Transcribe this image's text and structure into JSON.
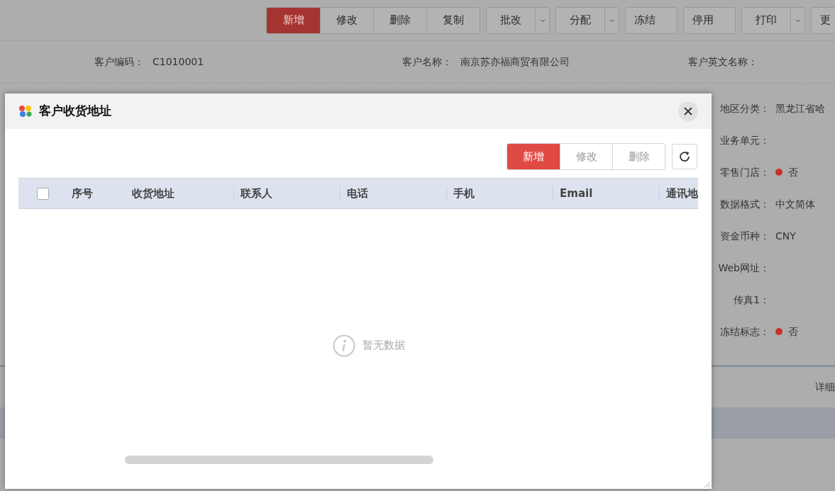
{
  "toolbar": {
    "groups": [
      {
        "kind": "joined",
        "buttons": [
          {
            "label": "新增",
            "primary": true
          },
          {
            "label": "修改",
            "primary": false
          },
          {
            "label": "删除",
            "primary": false
          },
          {
            "label": "复制",
            "primary": false
          }
        ]
      },
      {
        "kind": "split",
        "buttons": [
          {
            "label": "批改",
            "primary": false
          }
        ]
      },
      {
        "kind": "split",
        "buttons": [
          {
            "label": "分配",
            "primary": false
          }
        ]
      },
      {
        "kind": "plain",
        "buttons": [
          {
            "label": "冻结",
            "primary": false
          }
        ]
      },
      {
        "kind": "plain",
        "buttons": [
          {
            "label": "停用",
            "primary": false
          }
        ]
      },
      {
        "kind": "split",
        "buttons": [
          {
            "label": "打印",
            "primary": false
          }
        ]
      },
      {
        "kind": "plain",
        "buttons": [
          {
            "label": "更",
            "primary": false
          }
        ]
      }
    ]
  },
  "header_fields": [
    {
      "label": "客户编码：",
      "value": "C1010001"
    },
    {
      "label": "客户名称：",
      "value": "南京苏亦福商贸有限公司"
    },
    {
      "label": "客户英文名称："
    }
  ],
  "side_fields": [
    {
      "label": "地区分类：",
      "value": "黑龙江省哈",
      "kind": "text"
    },
    {
      "label": "业务单元：",
      "kind": "text"
    },
    {
      "label": "零售门店：",
      "value": "否",
      "kind": "flag",
      "color": "#c9302c"
    },
    {
      "label": "数据格式：",
      "value": "中文简体",
      "kind": "text"
    },
    {
      "label": "资金币种：",
      "value": "CNY",
      "kind": "text"
    },
    {
      "label": "Web网址：",
      "kind": "text"
    },
    {
      "label": "传真1：",
      "kind": "text"
    },
    {
      "label": "冻结标志：",
      "value": "否",
      "kind": "flag",
      "color": "#c9302c"
    }
  ],
  "detail_tab": "详细",
  "dialog": {
    "title": "客户收货地址",
    "buttons": [
      {
        "label": "新增",
        "primary": true
      },
      {
        "label": "修改",
        "primary": false
      },
      {
        "label": "删除",
        "primary": false
      }
    ],
    "table": {
      "select_all": {
        "checked": false
      },
      "columns": [
        "序号",
        "收货地址",
        "联系人",
        "电话",
        "手机",
        "Email",
        "通讯地"
      ]
    },
    "empty_text": "暂无数据"
  }
}
